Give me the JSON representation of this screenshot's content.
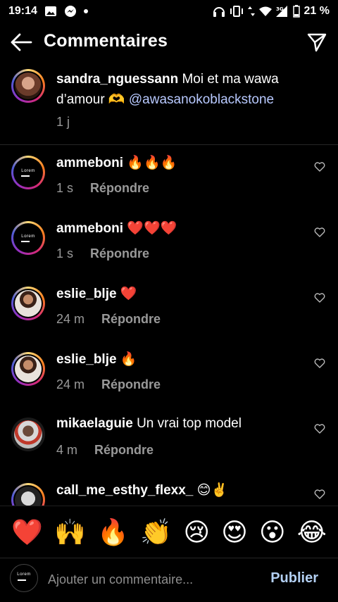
{
  "status_bar": {
    "time": "19:14",
    "battery": "21 %",
    "network": "3G"
  },
  "header": {
    "title": "Commentaires"
  },
  "caption": {
    "username": "sandra_nguessann",
    "text": "Moi et ma wawa d’amour 🫶",
    "mention": "@awasanokoblackstone",
    "time": "1 j"
  },
  "comments": [
    {
      "username": "ammeboni",
      "text": "🔥🔥🔥",
      "time": "1 s",
      "reply": "Répondre"
    },
    {
      "username": "ammeboni",
      "text": "❤️❤️❤️",
      "time": "1 s",
      "reply": "Répondre"
    },
    {
      "username": "eslie_blje",
      "text": "❤️",
      "time": "24 m",
      "reply": "Répondre"
    },
    {
      "username": "eslie_blje",
      "text": "🔥",
      "time": "24 m",
      "reply": "Répondre"
    },
    {
      "username": "mikaelaguie",
      "text": "Un vrai top model",
      "time": "4 m",
      "reply": "Répondre"
    },
    {
      "username": "call_me_esthy_flexx_",
      "text": "😊✌️",
      "time": "",
      "reply": ""
    }
  ],
  "avatar_logo_text": "Lorem",
  "reactions": [
    "❤️",
    "🙌",
    "🔥",
    "👏",
    "😢",
    "😍",
    "😮",
    "😂"
  ],
  "composer": {
    "placeholder": "Ajouter un commentaire...",
    "publish_label": "Publier"
  },
  "colors": {
    "mention": "#b8c9ff",
    "publish": "#b3d0f3",
    "muted": "#999999"
  }
}
